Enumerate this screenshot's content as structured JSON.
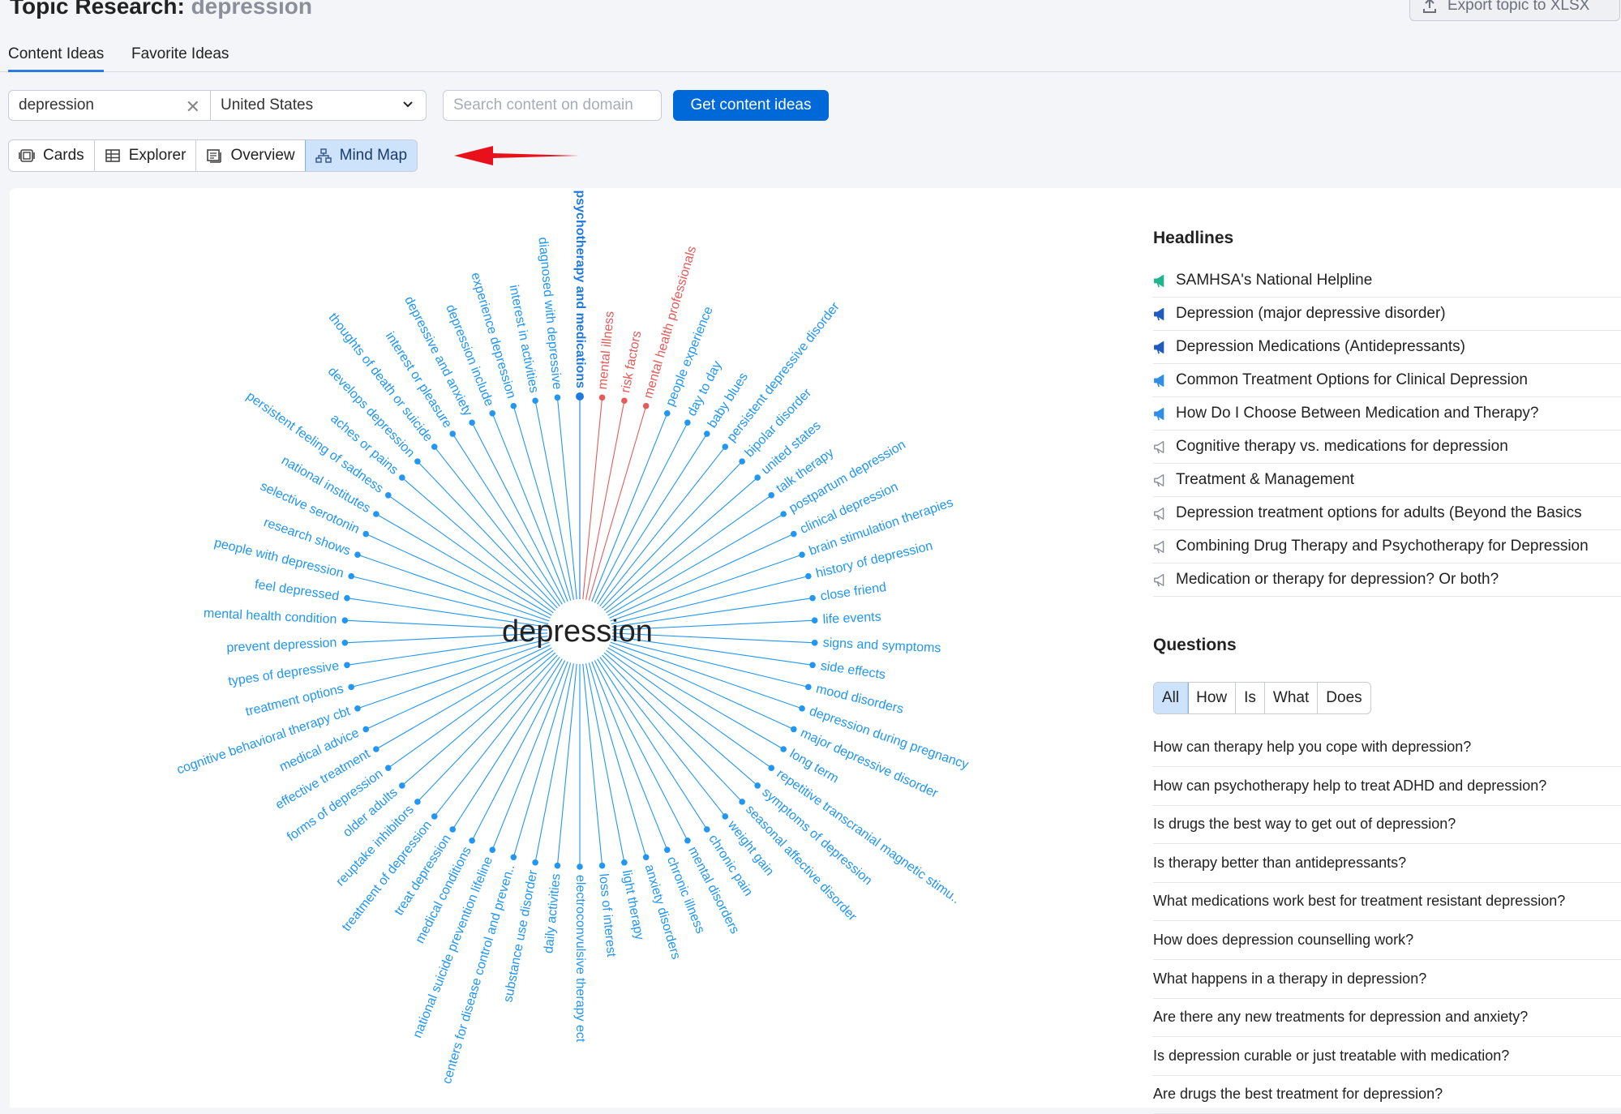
{
  "header": {
    "title_prefix": "Topic Research:",
    "topic": "depression",
    "export_label": "Export topic to XLSX"
  },
  "tabs": [
    {
      "label": "Content Ideas",
      "active": true
    },
    {
      "label": "Favorite Ideas",
      "active": false
    }
  ],
  "search": {
    "value": "depression",
    "country": "United States",
    "domain_placeholder": "Search content on domain",
    "submit_label": "Get content ideas"
  },
  "views": [
    {
      "label": "Cards",
      "icon": "cards-icon",
      "active": false
    },
    {
      "label": "Explorer",
      "icon": "table-icon",
      "active": false
    },
    {
      "label": "Overview",
      "icon": "overview-icon",
      "active": false
    },
    {
      "label": "Mind Map",
      "icon": "mindmap-icon",
      "active": true
    }
  ],
  "mindmap": {
    "center": "depression",
    "colors": {
      "normal": "#2196f3",
      "highlight": "#e45b5b",
      "selected": "#1f7ae0"
    },
    "nodes": [
      {
        "text": "psychotherapy and medications",
        "state": "selected"
      },
      {
        "text": "mental illness",
        "state": "highlight"
      },
      {
        "text": "risk factors",
        "state": "highlight"
      },
      {
        "text": "mental health professionals",
        "state": "highlight"
      },
      {
        "text": "people experience",
        "state": "normal"
      },
      {
        "text": "day to day",
        "state": "normal"
      },
      {
        "text": "baby blues",
        "state": "normal"
      },
      {
        "text": "persistent depressive disorder",
        "state": "normal"
      },
      {
        "text": "bipolar disorder",
        "state": "normal"
      },
      {
        "text": "united states",
        "state": "normal"
      },
      {
        "text": "talk therapy",
        "state": "normal"
      },
      {
        "text": "postpartum depression",
        "state": "normal"
      },
      {
        "text": "clinical depression",
        "state": "normal"
      },
      {
        "text": "brain stimulation therapies",
        "state": "normal"
      },
      {
        "text": "history of depression",
        "state": "normal"
      },
      {
        "text": "close friend",
        "state": "normal"
      },
      {
        "text": "life events",
        "state": "normal"
      },
      {
        "text": "signs and symptoms",
        "state": "normal"
      },
      {
        "text": "side effects",
        "state": "normal"
      },
      {
        "text": "mood disorders",
        "state": "normal"
      },
      {
        "text": "depression during pregnancy",
        "state": "normal"
      },
      {
        "text": "major depressive disorder",
        "state": "normal"
      },
      {
        "text": "long term",
        "state": "normal"
      },
      {
        "text": "repetitive transcranial magnetic stimu..",
        "state": "normal"
      },
      {
        "text": "symptoms of depression",
        "state": "normal"
      },
      {
        "text": "seasonal affective disorder",
        "state": "normal"
      },
      {
        "text": "weight gain",
        "state": "normal"
      },
      {
        "text": "chronic pain",
        "state": "normal"
      },
      {
        "text": "mental disorders",
        "state": "normal"
      },
      {
        "text": "chronic illness",
        "state": "normal"
      },
      {
        "text": "anxiety disorders",
        "state": "normal"
      },
      {
        "text": "light therapy",
        "state": "normal"
      },
      {
        "text": "loss of interest",
        "state": "normal"
      },
      {
        "text": "electroconvulsive therapy ect",
        "state": "normal"
      },
      {
        "text": "daily activities",
        "state": "normal"
      },
      {
        "text": "substance use disorder",
        "state": "normal"
      },
      {
        "text": "centers for disease control and preven..",
        "state": "normal"
      },
      {
        "text": "national suicide prevention lifeline",
        "state": "normal"
      },
      {
        "text": "medical conditions",
        "state": "normal"
      },
      {
        "text": "treat depression",
        "state": "normal"
      },
      {
        "text": "treatment of depression",
        "state": "normal"
      },
      {
        "text": "reuptake inhibitors",
        "state": "normal"
      },
      {
        "text": "older adults",
        "state": "normal"
      },
      {
        "text": "forms of depression",
        "state": "normal"
      },
      {
        "text": "effective treatment",
        "state": "normal"
      },
      {
        "text": "medical advice",
        "state": "normal"
      },
      {
        "text": "cognitive behavioral therapy cbt",
        "state": "normal"
      },
      {
        "text": "treatment options",
        "state": "normal"
      },
      {
        "text": "types of depressive",
        "state": "normal"
      },
      {
        "text": "prevent depression",
        "state": "normal"
      },
      {
        "text": "mental health condition",
        "state": "normal"
      },
      {
        "text": "feel depressed",
        "state": "normal"
      },
      {
        "text": "people with depression",
        "state": "normal"
      },
      {
        "text": "research shows",
        "state": "normal"
      },
      {
        "text": "selective serotonin",
        "state": "normal"
      },
      {
        "text": "national institutes",
        "state": "normal"
      },
      {
        "text": "persistent feeling of sadness",
        "state": "normal"
      },
      {
        "text": "aches or pains",
        "state": "normal"
      },
      {
        "text": "develops depression",
        "state": "normal"
      },
      {
        "text": "thoughts of death or suicide",
        "state": "normal"
      },
      {
        "text": "interest or pleasure",
        "state": "normal"
      },
      {
        "text": "depressive and anxiety",
        "state": "normal"
      },
      {
        "text": "depression include",
        "state": "normal"
      },
      {
        "text": "experience depression",
        "state": "normal"
      },
      {
        "text": "interest in activities",
        "state": "normal"
      },
      {
        "text": "diagnosed with depressive",
        "state": "normal"
      }
    ]
  },
  "headlines": {
    "title": "Headlines",
    "items": [
      {
        "text": "SAMHSA's National Helpline",
        "icon": "megaphone-icon",
        "color": "#1fb58f",
        "filled": true
      },
      {
        "text": "Depression (major depressive disorder)",
        "icon": "megaphone-icon",
        "color": "#1f5bbf",
        "filled": true
      },
      {
        "text": "Depression Medications (Antidepressants)",
        "icon": "megaphone-icon",
        "color": "#1f5bbf",
        "filled": true
      },
      {
        "text": "Common Treatment Options for Clinical Depression",
        "icon": "megaphone-icon",
        "color": "#2f8fe8",
        "filled": true
      },
      {
        "text": "How Do I Choose Between Medication and Therapy?",
        "icon": "megaphone-icon",
        "color": "#2f8fe8",
        "filled": true
      },
      {
        "text": "Cognitive therapy vs. medications for depression",
        "icon": "megaphone-icon",
        "color": "#8a8f99",
        "filled": false
      },
      {
        "text": "Treatment & Management",
        "icon": "megaphone-icon",
        "color": "#8a8f99",
        "filled": false
      },
      {
        "text": "Depression treatment options for adults (Beyond the Basics",
        "icon": "megaphone-icon",
        "color": "#8a8f99",
        "filled": false
      },
      {
        "text": "Combining Drug Therapy and Psychotherapy for Depression",
        "icon": "megaphone-icon",
        "color": "#8a8f99",
        "filled": false
      },
      {
        "text": "Medication or therapy for depression? Or both?",
        "icon": "megaphone-icon",
        "color": "#8a8f99",
        "filled": false
      }
    ]
  },
  "questions": {
    "title": "Questions",
    "filters": [
      {
        "label": "All",
        "active": true
      },
      {
        "label": "How",
        "active": false
      },
      {
        "label": "Is",
        "active": false
      },
      {
        "label": "What",
        "active": false
      },
      {
        "label": "Does",
        "active": false
      }
    ],
    "items": [
      "How can therapy help you cope with depression?",
      "How can psychotherapy help to treat ADHD and depression?",
      "Is drugs the best way to get out of depression?",
      "Is therapy better than antidepressants?",
      "What medications work best for treatment resistant depression?",
      "How does depression counselling work?",
      "What happens in a therapy in depression?",
      "Are there any new treatments for depression and anxiety?",
      "Is depression curable or just treatable with medication?",
      "Are drugs the best treatment for depression?"
    ]
  }
}
